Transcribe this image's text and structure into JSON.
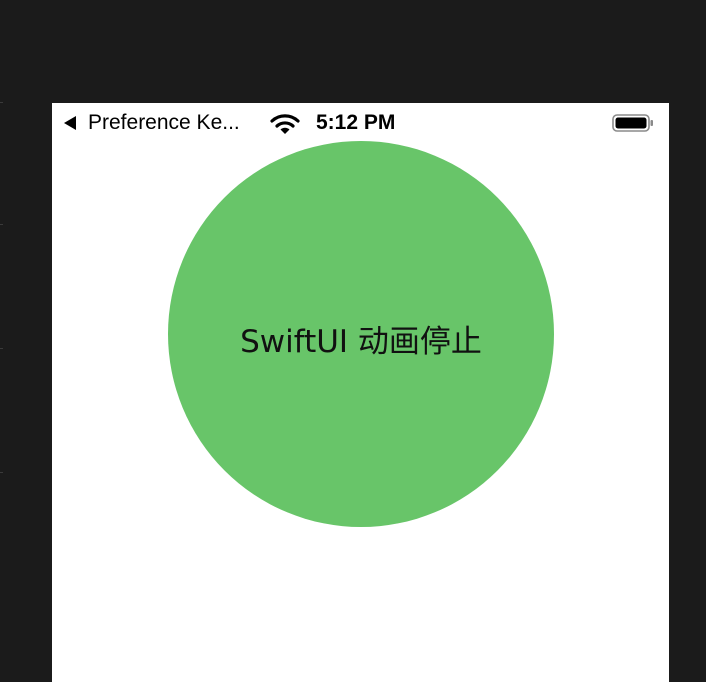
{
  "status_bar": {
    "back_label": "Preference Ke...",
    "time": "5:12 PM",
    "battery_level": 1.0
  },
  "content": {
    "circle_label": "SwiftUI 动画停止",
    "circle_color": "#68c569"
  },
  "colors": {
    "window_background": "#1b1b1b",
    "screen_background": "#ffffff"
  },
  "icons": {
    "back": "back-triangle-icon",
    "wifi": "wifi-icon",
    "battery": "battery-icon"
  }
}
